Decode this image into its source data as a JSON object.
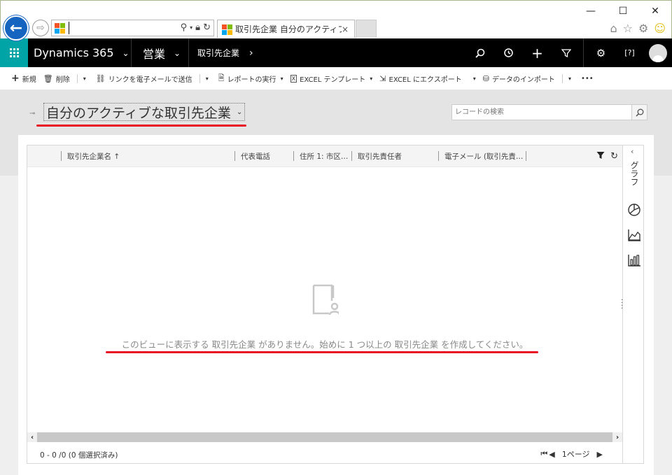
{
  "browser": {
    "address_value": "",
    "tab_title": "取引先企業 自分のアクティブ...",
    "tab_close": "×",
    "window_controls": {
      "minimize": "—",
      "maximize": "☐",
      "close": "✕"
    },
    "icons": [
      "back-icon",
      "forward-icon",
      "search-icon",
      "lock-icon",
      "refresh-icon",
      "home-icon",
      "star-icon",
      "gear-icon",
      "smiley-icon"
    ]
  },
  "nav": {
    "brand": "Dynamics 365",
    "area": "営業",
    "entity": "取引先企業",
    "icons": [
      "search-icon",
      "history-icon",
      "plus-icon",
      "filter-icon",
      "settings-icon",
      "help-icon",
      "user-avatar"
    ]
  },
  "commands": {
    "new": "新規",
    "delete": "削除",
    "email_link": "リンクを電子メールで送信",
    "run_report": "レポートの実行",
    "excel_template": "EXCEL テンプレート",
    "excel_export": "EXCEL にエクスポート",
    "import_data": "データのインポート",
    "more": "•••"
  },
  "view": {
    "title": "自分のアクティブな取引先企業",
    "search_placeholder": "レコードの検索"
  },
  "grid": {
    "columns": [
      "取引先企業名 ↑",
      "代表電話",
      "住所 1: 市区…",
      "取引先責任者",
      "電子メール (取引先責…"
    ],
    "empty_message": "このビューに表示する 取引先企業 がありません。始めに 1 つ以上の 取引先企業 を作成してください。",
    "record_count": "0 - 0 /0 (0 個選択済み)",
    "page_label": "1ページ"
  },
  "side_panel": {
    "label": "グラフ"
  },
  "colors": {
    "accent": "#00a4a6",
    "nav_bg": "#000000",
    "highlight": "#e81123",
    "back_button": "#1565c0"
  }
}
